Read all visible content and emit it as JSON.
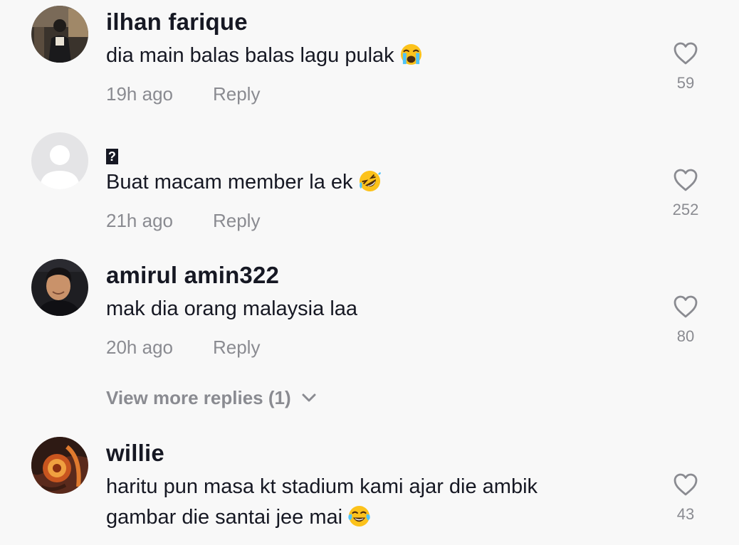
{
  "colors": {
    "background": "#f8f8f8",
    "primary_text": "#161823",
    "secondary_text": "#8a8b91"
  },
  "comments": [
    {
      "username": "ilhan farique",
      "text": "dia main balas balas lagu pulak",
      "emoji": "loudly-crying-face-emoji",
      "time": "19h ago",
      "reply_label": "Reply",
      "likes": "59",
      "avatar": "photo-avatar"
    },
    {
      "username": "?",
      "text": "Buat macam member la ek",
      "emoji": "rolling-on-floor-laughing-emoji",
      "time": "21h ago",
      "reply_label": "Reply",
      "likes": "252",
      "avatar": "default-avatar"
    },
    {
      "username": "amirul amin322",
      "text": "mak dia orang malaysia laa",
      "time": "20h ago",
      "reply_label": "Reply",
      "likes": "80",
      "avatar": "photo-avatar",
      "view_more_replies": "View more replies (1)"
    },
    {
      "username": "willie",
      "text_line1": "haritu pun masa kt stadium kami ajar die ambik",
      "text_line2": "gambar die santai jee mai",
      "emoji": "face-with-tears-of-joy-emoji",
      "likes": "43",
      "avatar": "photo-avatar"
    }
  ]
}
